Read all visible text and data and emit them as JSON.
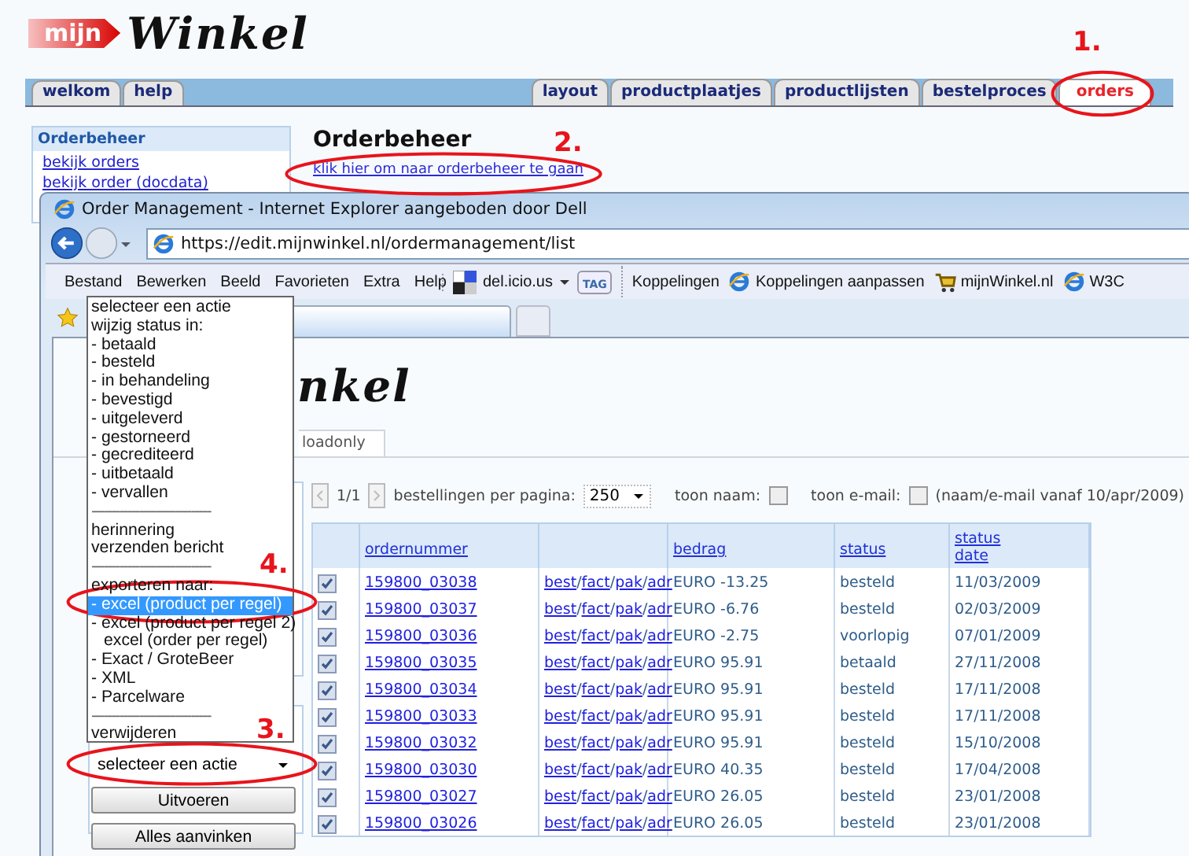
{
  "background_page": {
    "logo": {
      "badge": "mijn",
      "wordmark": "Winkel"
    },
    "tabs_left": [
      {
        "label": "welkom",
        "selected": false
      },
      {
        "label": "help",
        "selected": false
      }
    ],
    "tabs_right": [
      {
        "label": "layout",
        "selected": false
      },
      {
        "label": "productplaatjes",
        "selected": false
      },
      {
        "label": "productlijsten",
        "selected": false
      },
      {
        "label": "bestelproces",
        "selected": false
      },
      {
        "label": "orders",
        "selected": true
      }
    ],
    "sidebar": {
      "title": "Orderbeheer",
      "links": [
        "bekijk orders",
        "bekijk order (docdata)"
      ]
    },
    "heading": "Orderbeheer",
    "link": "klik hier om naar orderbeheer te gaan"
  },
  "browser_window": {
    "title": "Order Management - Internet Explorer aangeboden door Dell",
    "address": "https://edit.mijnwinkel.nl/ordermanagement/list",
    "menu": [
      "Bestand",
      "Bewerken",
      "Beeld",
      "Favorieten",
      "Extra",
      "Help"
    ],
    "bookmark_button": "del.icio.us",
    "tag_button": "TAG",
    "links_label": "Koppelingen",
    "links": [
      {
        "label": "Koppelingen aanpassen",
        "kind": "ie"
      },
      {
        "label": "mijnWinkel.nl",
        "kind": "cart"
      },
      {
        "label": "W3C",
        "kind": "ie"
      }
    ],
    "page": {
      "logo_fragment": "nkel",
      "tab": "loadonly",
      "pager": {
        "page": "1/1",
        "per_page_label": "bestellingen per pagina:",
        "per_page": "250",
        "show_name_label": "toon naam:",
        "show_name": false,
        "show_email_label": "toon e-mail:",
        "show_email": false,
        "note": "(naam/e-mail vanaf 10/apr/2009)"
      },
      "table": {
        "link_separator": "/",
        "columns": [
          {
            "kind": "check"
          },
          {
            "kind": "sort",
            "label": "ordernummer"
          },
          {
            "kind": "links"
          },
          {
            "kind": "sort",
            "label": "bedrag"
          },
          {
            "kind": "sort",
            "label": "status"
          },
          {
            "kind": "sort",
            "label": "status date"
          }
        ],
        "rows": [
          {
            "checked": true,
            "order": "159800_03038",
            "links": [
              "best",
              "fact",
              "pak",
              "adr"
            ],
            "amount": "EURO -13.25",
            "status": "besteld",
            "date": "11/03/2009"
          },
          {
            "checked": true,
            "order": "159800_03037",
            "links": [
              "best",
              "fact",
              "pak",
              "adr"
            ],
            "amount": "EURO -6.76",
            "status": "besteld",
            "date": "02/03/2009"
          },
          {
            "checked": true,
            "order": "159800_03036",
            "links": [
              "best",
              "fact",
              "pak",
              "adr"
            ],
            "amount": "EURO -2.75",
            "status": "voorlopig",
            "date": "07/01/2009"
          },
          {
            "checked": true,
            "order": "159800_03035",
            "links": [
              "best",
              "fact",
              "pak",
              "adr"
            ],
            "amount": "EURO 95.91",
            "status": "betaald",
            "date": "27/11/2008"
          },
          {
            "checked": true,
            "order": "159800_03034",
            "links": [
              "best",
              "fact",
              "pak",
              "adr"
            ],
            "amount": "EURO 95.91",
            "status": "besteld",
            "date": "17/11/2008"
          },
          {
            "checked": true,
            "order": "159800_03033",
            "links": [
              "best",
              "fact",
              "pak",
              "adr"
            ],
            "amount": "EURO 95.91",
            "status": "besteld",
            "date": "17/11/2008"
          },
          {
            "checked": true,
            "order": "159800_03032",
            "links": [
              "best",
              "fact",
              "pak",
              "adr"
            ],
            "amount": "EURO 95.91",
            "status": "besteld",
            "date": "15/10/2008"
          },
          {
            "checked": true,
            "order": "159800_03030",
            "links": [
              "best",
              "fact",
              "pak",
              "adr"
            ],
            "amount": "EURO 40.35",
            "status": "besteld",
            "date": "17/04/2008"
          },
          {
            "checked": true,
            "order": "159800_03027",
            "links": [
              "best",
              "fact",
              "pak",
              "adr"
            ],
            "amount": "EURO 26.05",
            "status": "besteld",
            "date": "23/01/2008"
          },
          {
            "checked": true,
            "order": "159800_03026",
            "links": [
              "best",
              "fact",
              "pak",
              "adr"
            ],
            "amount": "EURO 26.05",
            "status": "besteld",
            "date": "23/01/2008"
          }
        ]
      }
    }
  },
  "dropdown": {
    "items": [
      {
        "label": "selecteer een actie",
        "kind": "option",
        "selected": false
      },
      {
        "label": "wijzig status in:",
        "kind": "option",
        "selected": false
      },
      {
        "label": "- betaald",
        "kind": "option",
        "selected": false
      },
      {
        "label": "- besteld",
        "kind": "option",
        "selected": false
      },
      {
        "label": "- in behandeling",
        "kind": "option",
        "selected": false
      },
      {
        "label": "- bevestigd",
        "kind": "option",
        "selected": false
      },
      {
        "label": "- uitgeleverd",
        "kind": "option",
        "selected": false
      },
      {
        "label": "- gestorneerd",
        "kind": "option",
        "selected": false
      },
      {
        "label": "- gecrediteerd",
        "kind": "option",
        "selected": false
      },
      {
        "label": "- uitbetaald",
        "kind": "option",
        "selected": false
      },
      {
        "label": "- vervallen",
        "kind": "option",
        "selected": false
      },
      {
        "label": "------------------------------",
        "kind": "separator",
        "selected": false
      },
      {
        "label": "herinnering",
        "kind": "option",
        "selected": false
      },
      {
        "label": "verzenden bericht",
        "kind": "option",
        "selected": false
      },
      {
        "label": "------------------------------",
        "kind": "separator",
        "selected": false
      },
      {
        "label": "exporteren naar:",
        "kind": "option",
        "selected": false
      },
      {
        "label": "- excel (product per regel)",
        "kind": "option",
        "selected": true
      },
      {
        "label": "- excel (product per regel 2)",
        "kind": "option",
        "selected": false
      },
      {
        "label": "excel (order per regel)",
        "kind": "indented",
        "selected": false
      },
      {
        "label": "- Exact / GroteBeer",
        "kind": "option",
        "selected": false
      },
      {
        "label": "- XML",
        "kind": "option",
        "selected": false
      },
      {
        "label": "- Parcelware",
        "kind": "option",
        "selected": false
      },
      {
        "label": "------------------------------",
        "kind": "separator",
        "selected": false
      },
      {
        "label": "verwijderen",
        "kind": "option",
        "selected": false
      }
    ],
    "select": "selecteer een actie",
    "buttons": [
      "Uitvoeren",
      "Alles aanvinken"
    ]
  },
  "annotations": [
    {
      "number": "1."
    },
    {
      "number": "2."
    },
    {
      "number": "4."
    },
    {
      "number": "3."
    }
  ]
}
